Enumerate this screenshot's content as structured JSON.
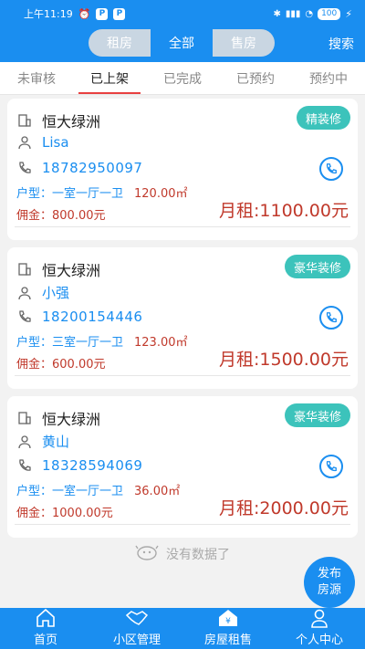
{
  "status": {
    "time": "上午11:19",
    "battery": "100"
  },
  "header": {
    "segments": [
      "租房",
      "全部",
      "售房"
    ],
    "active_segment": 1,
    "search_label": "搜索"
  },
  "tabs": [
    "未审核",
    "已上架",
    "已完成",
    "已预约",
    "预约中"
  ],
  "active_tab": 1,
  "listings": [
    {
      "estate": "恒大绿洲",
      "badge": "精装修",
      "contact": "Lisa",
      "phone": "18782950097",
      "layout": "户型：一室一厅一卫",
      "area": "120.00㎡",
      "commission": "佣金：800.00元",
      "rent": "月租:1100.00元"
    },
    {
      "estate": "恒大绿洲",
      "badge": "豪华装修",
      "contact": "小强",
      "phone": "18200154446",
      "layout": "户型：三室一厅一卫",
      "area": "123.00㎡",
      "commission": "佣金：600.00元",
      "rent": "月租:1500.00元"
    },
    {
      "estate": "恒大绿洲",
      "badge": "豪华装修",
      "contact": "黄山",
      "phone": "18328594069",
      "layout": "户型：一室一厅一卫",
      "area": "36.00㎡",
      "commission": "佣金：1000.00元",
      "rent": "月租:2000.00元"
    }
  ],
  "empty_text": "没有数据了",
  "publish_button": {
    "line1": "发布",
    "line2": "房源"
  },
  "bottom_nav": [
    "首页",
    "小区管理",
    "房屋租售",
    "个人中心"
  ],
  "colors": {
    "primary": "#1a8ef0",
    "badge": "#3cc3bb",
    "price": "#c0392b"
  }
}
